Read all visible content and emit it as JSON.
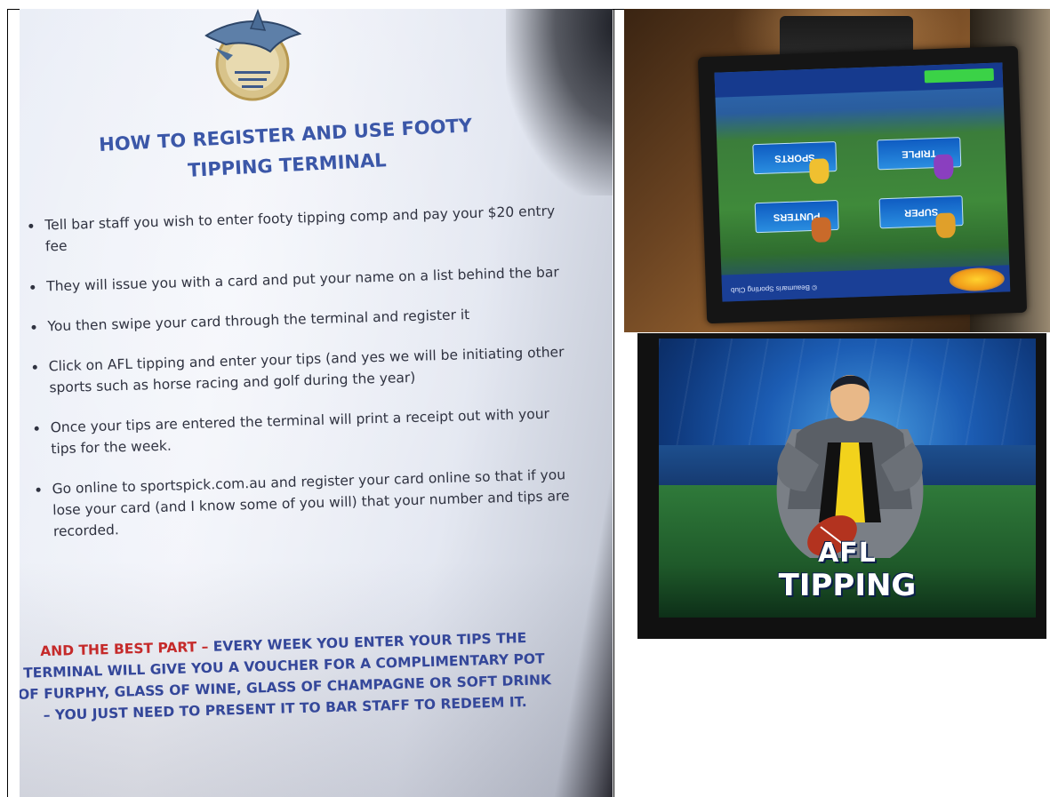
{
  "flyer": {
    "title_line1": "HOW TO REGISTER AND USE FOOTY",
    "title_line2": "TIPPING TERMINAL",
    "steps": [
      "Tell bar staff you wish to enter footy tipping comp and pay your $20 entry fee",
      "They will issue you with a card and put your name on a list behind the bar",
      "You then swipe your card through the terminal and register it",
      "Click on AFL tipping and enter your tips (and yes we will be initiating other sports such as horse racing and golf during the year)",
      "Once your tips are entered the terminal will print a receipt out with your tips for the week.",
      "Go online to sportspick.com.au and register your card online so that if you lose your card (and I know some of you will) that your number and tips are recorded."
    ],
    "footer_accent": "AND THE BEST PART –",
    "footer_text": " EVERY WEEK YOU ENTER YOUR TIPS THE TERMINAL WILL GIVE YOU A VOUCHER FOR A COMPLIMENTARY POT OF FURPHY, GLASS OF WINE, GLASS OF CHAMPAGNE OR SOFT DRINK – YOU JUST NEED TO PRESENT IT TO BAR STAFF TO REDEEM IT."
  },
  "terminal": {
    "tiles": [
      "SPORTS",
      "TRIPLE",
      "PUNTERS",
      "SUPER"
    ],
    "footer_text": "© Beaumaris Sporting Club"
  },
  "afl_screen": {
    "title_line1": "AFL",
    "title_line2": "TIPPING"
  }
}
